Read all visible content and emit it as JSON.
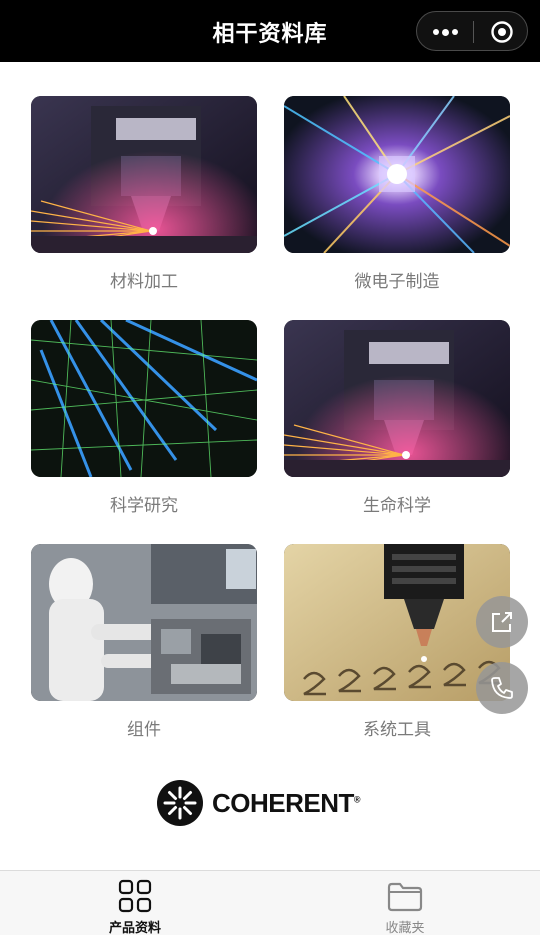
{
  "header": {
    "title": "相干资料库"
  },
  "categories": [
    {
      "label": "材料加工",
      "image": "laser-cutting-head-sparks"
    },
    {
      "label": "微电子制造",
      "image": "microchip-light-burst"
    },
    {
      "label": "科学研究",
      "image": "laser-beams-green-particles"
    },
    {
      "label": "生命科学",
      "image": "laser-cutting-head-sparks"
    },
    {
      "label": "组件",
      "image": "cleanroom-technician"
    },
    {
      "label": "系统工具",
      "image": "laser-nozzle-metal-sheet"
    }
  ],
  "brand": {
    "name": "COHERENT",
    "mark": "®"
  },
  "floating": {
    "share": "share-icon",
    "phone": "phone-icon"
  },
  "tabbar": {
    "items": [
      {
        "label": "产品资料",
        "icon": "grid-icon",
        "active": true
      },
      {
        "label": "收藏夹",
        "icon": "folder-icon",
        "active": false
      }
    ]
  },
  "colors": {
    "topbar": "#000000",
    "label": "#7a7a7a",
    "fab": "#969696"
  }
}
